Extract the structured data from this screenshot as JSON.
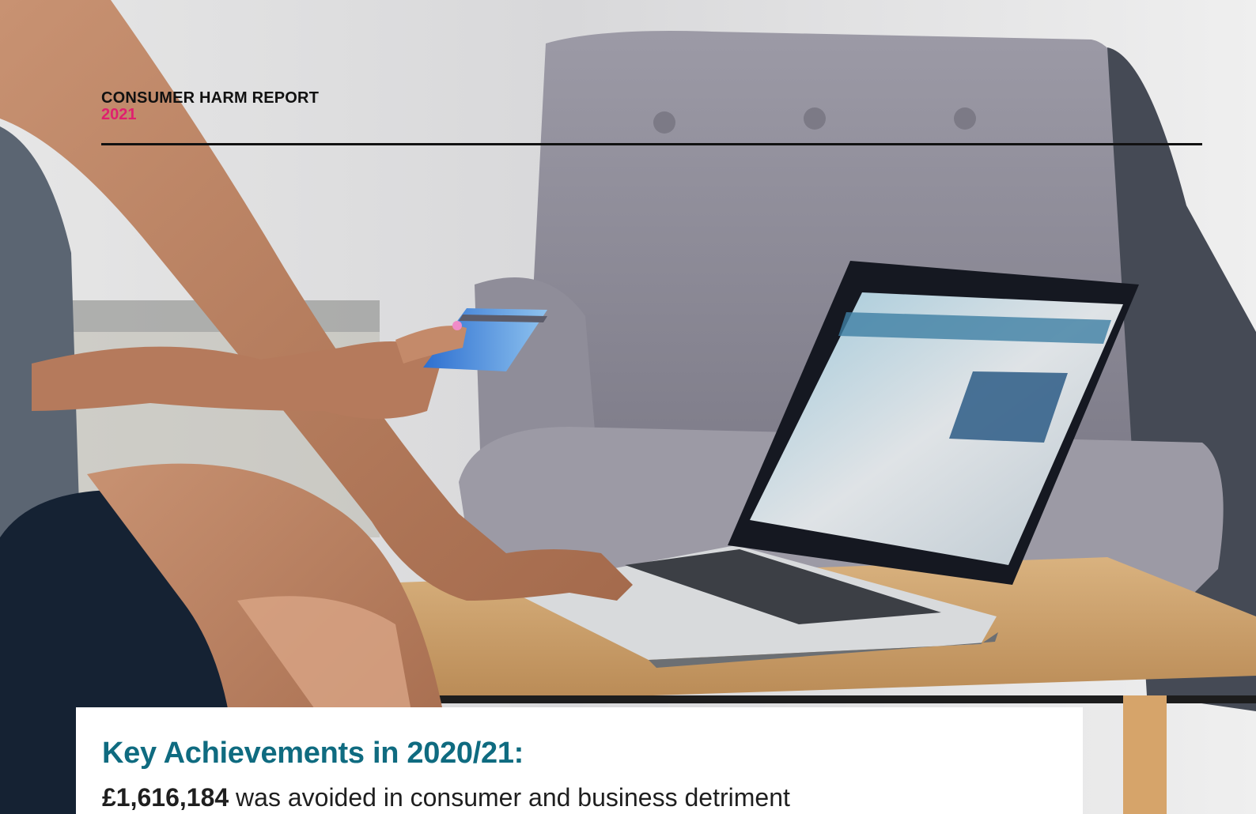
{
  "header": {
    "title": "CONSUMER HARM REPORT",
    "year": "2021"
  },
  "card": {
    "heading": "Key Achievements in 2020/21:",
    "amount": "£1,616,184",
    "amount_text": " was avoided in consumer and business detriment"
  },
  "colors": {
    "heading": "#0f6b80",
    "year": "#e0206f",
    "rule": "#111111"
  }
}
